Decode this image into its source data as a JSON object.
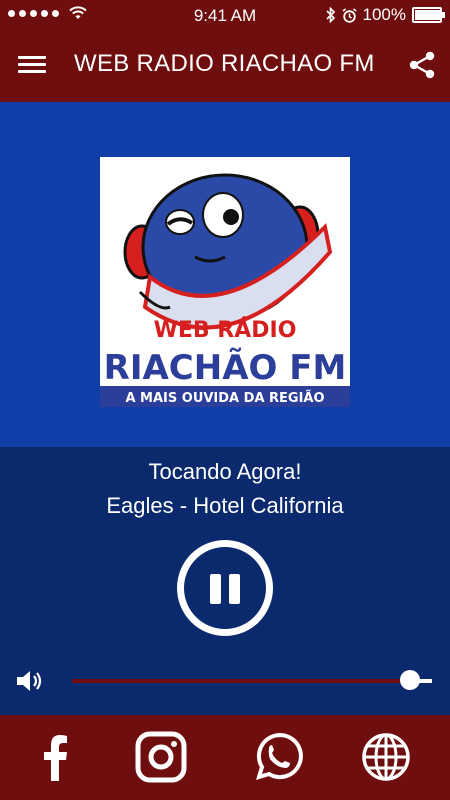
{
  "status_bar": {
    "time": "9:41 AM",
    "battery": "100%",
    "battery_level": 1.0,
    "signal_dots": 5
  },
  "header": {
    "title": "WEB RADIO RIACHAO FM",
    "menu_icon": "hamburger-menu-icon",
    "share_icon": "share-icon"
  },
  "logo": {
    "line1": "WEB RÁDIO",
    "line2": "RIACHÃO FM",
    "tagline": "A MAIS OUVIDA DA REGIÃO"
  },
  "player": {
    "now_playing_label": "Tocando Agora!",
    "track": "Eagles - Hotel California",
    "state": "playing",
    "control_icon": "pause-icon",
    "volume_icon": "speaker-icon",
    "volume": 0.94
  },
  "footer": {
    "links": [
      {
        "name": "facebook",
        "icon": "facebook-icon"
      },
      {
        "name": "instagram",
        "icon": "instagram-icon"
      },
      {
        "name": "whatsapp",
        "icon": "whatsapp-icon"
      },
      {
        "name": "website",
        "icon": "globe-icon"
      }
    ]
  },
  "colors": {
    "bar": "#6f0e0e",
    "top_panel": "#0f3ea8",
    "bottom_panel": "#0b2a6e",
    "logo_red": "#d62020",
    "logo_blue": "#2b3f9a"
  }
}
